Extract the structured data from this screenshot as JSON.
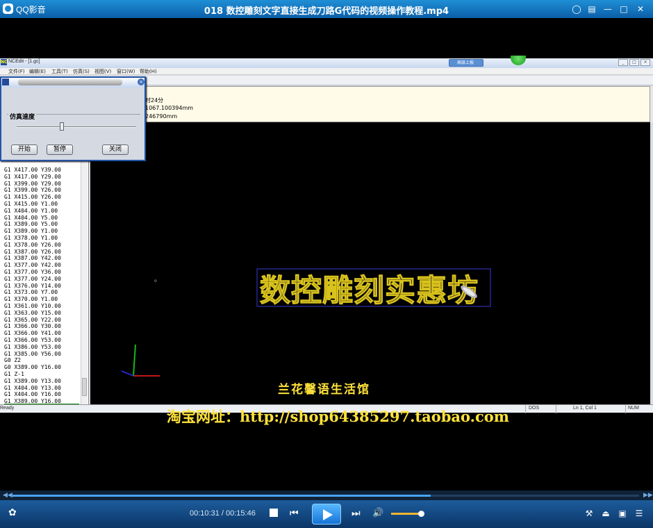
{
  "player": {
    "app_name": "QQ影音",
    "file_title": "018 数控雕刻文字直接生成刀路G代码的视频操作教程.mp4",
    "current_time": "00:10:31",
    "separator": " / ",
    "total_time": "00:15:46",
    "progress": 0.667,
    "buffered": 0.667,
    "volume": 0.8
  },
  "ncedit": {
    "window_title": "NCEdit - [1.gc]",
    "badge_text": "高级上报",
    "menus": [
      "文件(F)",
      "编辑(E)",
      "工具(T)",
      "仿真(S)",
      "视图(V)",
      "窗口(W)",
      "帮助(H)"
    ],
    "info_lines": [
      "时24分",
      "1067.100394mm",
      "246790mm"
    ],
    "code_lines": [
      "G1 X417.00 Y39.00",
      "G1 X417.00 Y29.00",
      "G1 X399.00 Y29.00",
      "G1 X399.00 Y26.00",
      "G1 X415.00 Y26.00",
      "G1 X415.00 Y1.00",
      "G1 X404.00 Y1.00",
      "G1 X404.00 Y5.00",
      "G1 X389.00 Y5.00",
      "G1 X389.00 Y1.00",
      "G1 X378.00 Y1.00",
      "G1 X378.00 Y26.00",
      "G1 X387.00 Y26.00",
      "G1 X387.00 Y42.00",
      "G1 X377.00 Y42.00",
      "G1 X377.00 Y36.00",
      "G1 X377.00 Y24.00",
      "G1 X376.00 Y14.00",
      "G1 X373.00 Y7.00",
      "G1 X370.00 Y1.00",
      "G1 X361.00 Y10.00",
      "G1 X363.00 Y15.00",
      "G1 X365.00 Y22.00",
      "G1 X366.00 Y30.00",
      "G1 X366.00 Y41.00",
      "G1 X366.00 Y53.00",
      "G1 X386.00 Y53.00",
      "G1 X385.00 Y56.00",
      "G0 Z2",
      "G0 X389.00 Y16.00",
      "G1 Z-1",
      "G1 X389.00 Y13.00",
      "G1 X404.00 Y13.00",
      "G1 X404.00 Y16.00",
      "G1 X389.00 Y16.00"
    ],
    "engraved_text": "数控雕刻实惠坊",
    "status_ready": "Ready",
    "status_dos": "DOS",
    "status_pos": "Ln 1, Col 1",
    "status_num": "NUM"
  },
  "sim_dialog": {
    "group_label": "仿真速度",
    "slider_value": 0.36,
    "start_label": "开始",
    "pause_label": "暂停",
    "close_label": "关闭"
  },
  "captions": {
    "line1": "兰花馨语生活馆",
    "line2": "淘宝网址：http://shop64385297.taobao.com"
  },
  "colors": {
    "caption": "#ffe23a",
    "player_bar": "#1d5c9c",
    "accent": "#4aa3f0"
  }
}
